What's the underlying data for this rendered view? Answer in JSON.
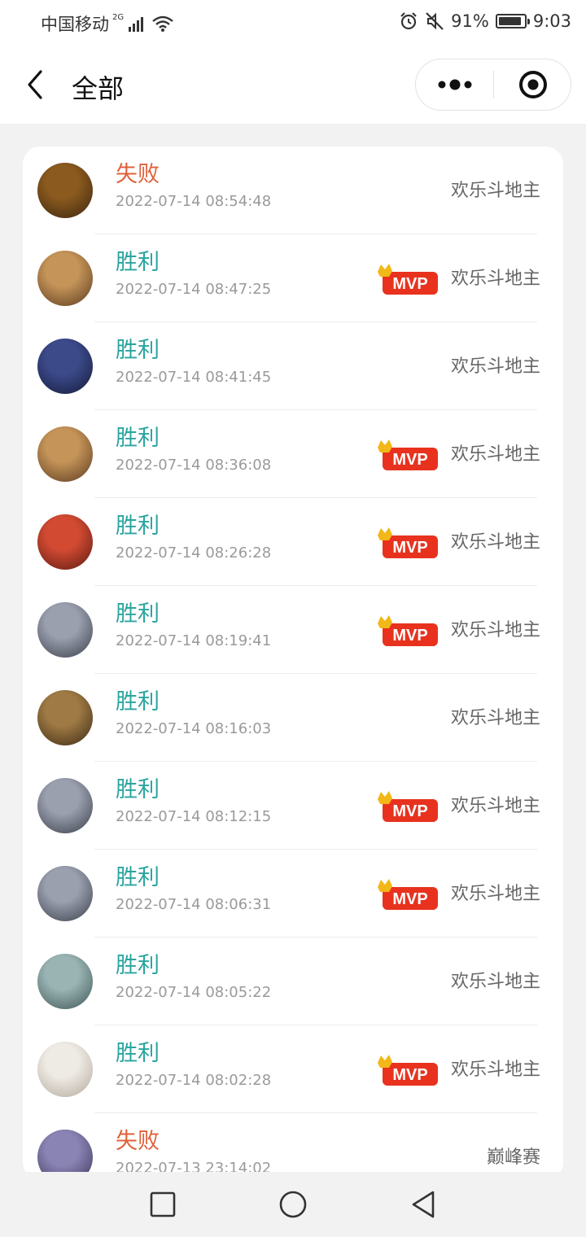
{
  "status_bar": {
    "carrier": "中国移动",
    "network": "2G",
    "battery_text": "91%",
    "battery_level": 0.91,
    "time": "9:03",
    "icons": [
      "signal-icon",
      "wifi-icon",
      "alarm-icon",
      "mute-icon",
      "battery-icon"
    ]
  },
  "nav": {
    "title": "全部",
    "back_icon": "chevron-left-icon",
    "more_icon": "more-dots-icon",
    "close_icon": "target-circle-icon"
  },
  "records": [
    {
      "result": "失败",
      "status": "lose",
      "time": "2022-07-14 08:54:48",
      "mode": "欢乐斗地主",
      "mvp": false,
      "avatar_colors": [
        "#8a5a1e",
        "#3a2410"
      ]
    },
    {
      "result": "胜利",
      "status": "win",
      "time": "2022-07-14 08:47:25",
      "mode": "欢乐斗地主",
      "mvp": true,
      "avatar_colors": [
        "#c49458",
        "#5b3a20"
      ]
    },
    {
      "result": "胜利",
      "status": "win",
      "time": "2022-07-14 08:41:45",
      "mode": "欢乐斗地主",
      "mvp": false,
      "avatar_colors": [
        "#3c4a8a",
        "#141a3a"
      ]
    },
    {
      "result": "胜利",
      "status": "win",
      "time": "2022-07-14 08:36:08",
      "mode": "欢乐斗地主",
      "mvp": true,
      "avatar_colors": [
        "#c49458",
        "#5b3a20"
      ]
    },
    {
      "result": "胜利",
      "status": "win",
      "time": "2022-07-14 08:26:28",
      "mode": "欢乐斗地主",
      "mvp": true,
      "avatar_colors": [
        "#d24a32",
        "#5a1a12"
      ]
    },
    {
      "result": "胜利",
      "status": "win",
      "time": "2022-07-14 08:19:41",
      "mode": "欢乐斗地主",
      "mvp": true,
      "avatar_colors": [
        "#9aa0ae",
        "#3a3e4a"
      ]
    },
    {
      "result": "胜利",
      "status": "win",
      "time": "2022-07-14 08:16:03",
      "mode": "欢乐斗地主",
      "mvp": false,
      "avatar_colors": [
        "#a07a44",
        "#3a2a14"
      ]
    },
    {
      "result": "胜利",
      "status": "win",
      "time": "2022-07-14 08:12:15",
      "mode": "欢乐斗地主",
      "mvp": true,
      "avatar_colors": [
        "#9aa0ae",
        "#3a3e4a"
      ]
    },
    {
      "result": "胜利",
      "status": "win",
      "time": "2022-07-14 08:06:31",
      "mode": "欢乐斗地主",
      "mvp": true,
      "avatar_colors": [
        "#9aa0ae",
        "#3a3e4a"
      ]
    },
    {
      "result": "胜利",
      "status": "win",
      "time": "2022-07-14 08:05:22",
      "mode": "欢乐斗地主",
      "mvp": false,
      "avatar_colors": [
        "#9ab4b4",
        "#3e5454"
      ]
    },
    {
      "result": "胜利",
      "status": "win",
      "time": "2022-07-14 08:02:28",
      "mode": "欢乐斗地主",
      "mvp": true,
      "avatar_colors": [
        "#eeeae4",
        "#b2a89a"
      ]
    },
    {
      "result": "失败",
      "status": "lose",
      "time": "2022-07-13 23:14:02",
      "mode": "巅峰赛",
      "mvp": false,
      "avatar_colors": [
        "#8a84b4",
        "#3a3458"
      ]
    }
  ],
  "mvp_badge": {
    "label": "MVP",
    "color": "#e8321e",
    "crown_color": "#f2b718"
  },
  "colors": {
    "win": "#2aa5a0",
    "lose": "#e0603a"
  },
  "system_nav": {
    "icons": [
      "square-recents-icon",
      "circle-home-icon",
      "triangle-back-icon"
    ]
  }
}
